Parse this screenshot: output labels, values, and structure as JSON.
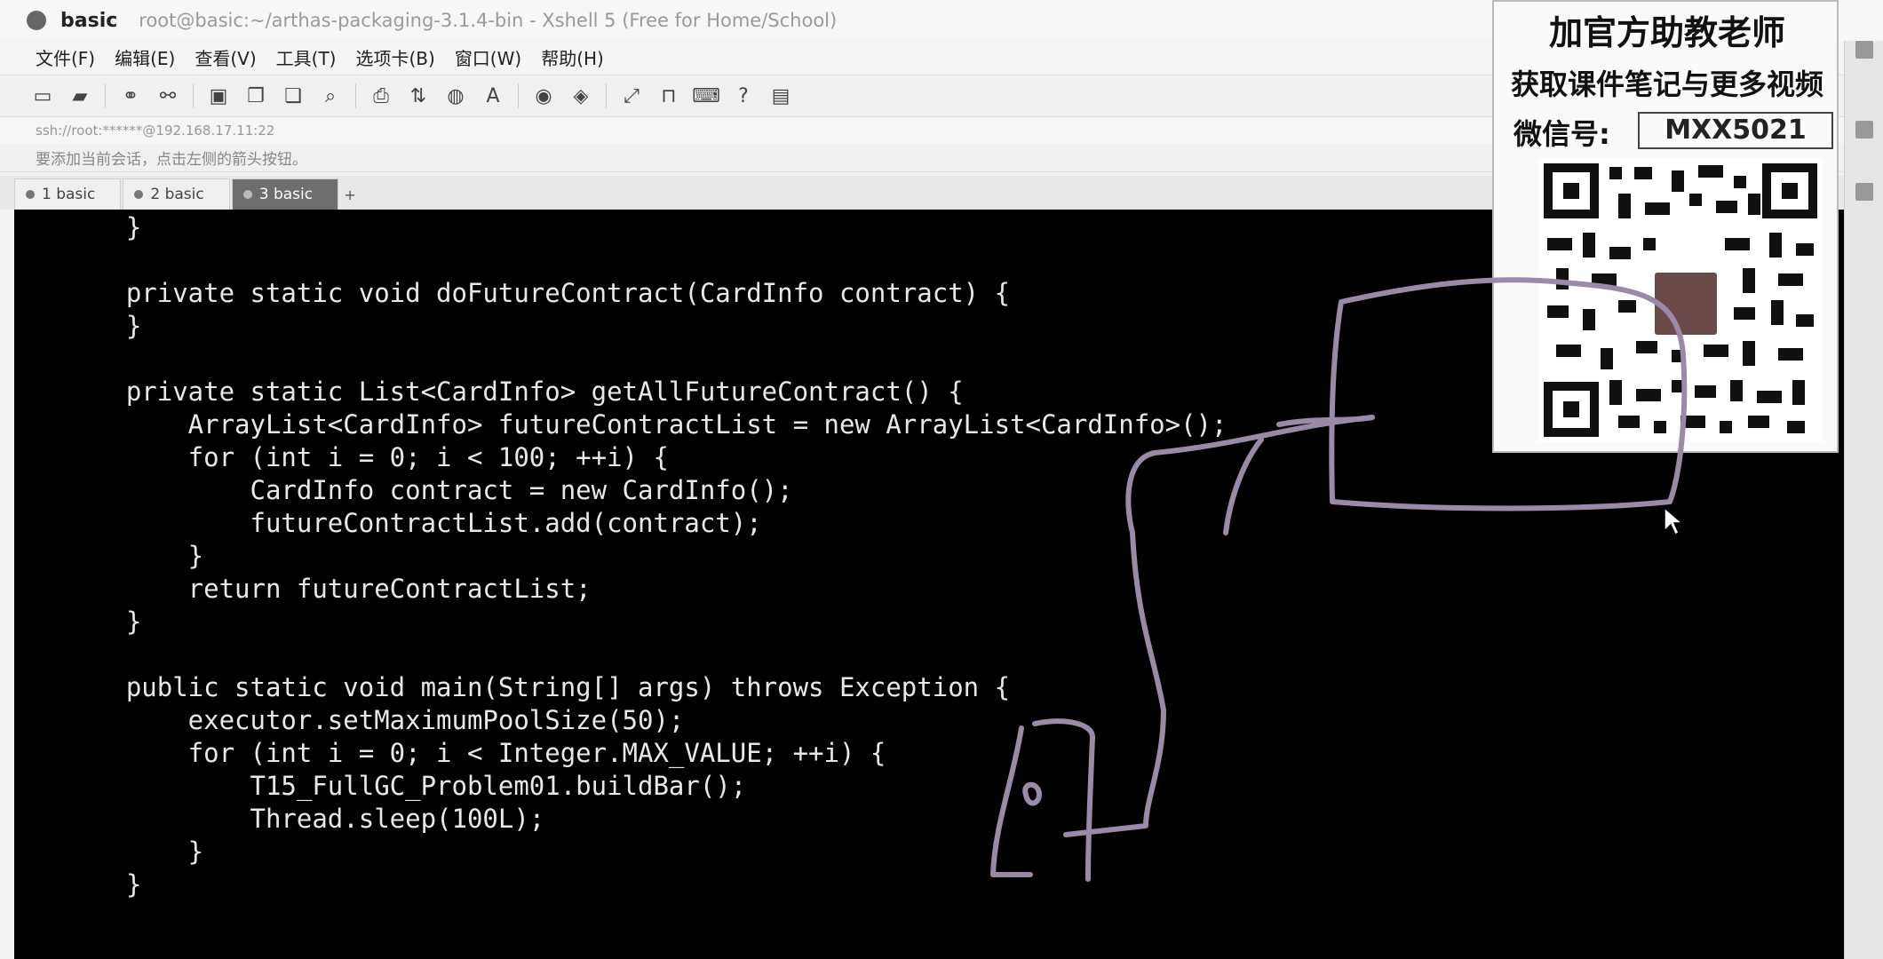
{
  "window": {
    "title_main": "basic",
    "title_sub": "root@basic:~/arthas-packaging-3.1.4-bin - Xshell 5 (Free for Home/School)"
  },
  "menu": [
    "文件(F)",
    "编辑(E)",
    "查看(V)",
    "工具(T)",
    "选项卡(B)",
    "窗口(W)",
    "帮助(H)"
  ],
  "toolbar_icons": [
    "new-session-icon",
    "open-folder-icon",
    "reconnect-icon",
    "disconnect-icon",
    "properties-icon",
    "copy-icon",
    "paste-icon",
    "find-icon",
    "print-icon",
    "transfer-icon",
    "globe-icon",
    "font-icon",
    "color-scheme-icon",
    "script-icon",
    "fullscreen-icon",
    "lock-icon",
    "keyboard-icon",
    "help-icon",
    "chat-icon"
  ],
  "address": "ssh://root:******@192.168.17.11:22",
  "hint": "要添加当前会话，点击左侧的箭头按钮。",
  "tabs": [
    {
      "label": "1 basic",
      "active": false
    },
    {
      "label": "2 basic",
      "active": false
    },
    {
      "label": "3 basic",
      "active": true
    }
  ],
  "tab_add": "+",
  "code_lines": [
    "    }",
    "",
    "    private static void doFutureContract(CardInfo contract) {",
    "    }",
    "",
    "    private static List<CardInfo> getAllFutureContract() {",
    "        ArrayList<CardInfo> futureContractList = new ArrayList<CardInfo>();",
    "        for (int i = 0; i < 100; ++i) {",
    "            CardInfo contract = new CardInfo();",
    "            futureContractList.add(contract);",
    "        }",
    "        return futureContractList;",
    "    }",
    "",
    "    public static void main(String[] args) throws Exception {",
    "        executor.setMaximumPoolSize(50);",
    "        for (int i = 0; i < Integer.MAX_VALUE; ++i) {",
    "            T15_FullGC_Problem01.buildBar();",
    "            Thread.sleep(100L);",
    "        }",
    "    }"
  ],
  "overlay": {
    "title": "加官方助教老师",
    "subtitle": "获取课件笔记与更多视频",
    "wechat_label": "微信号:",
    "wechat_id": "MXX5021"
  }
}
